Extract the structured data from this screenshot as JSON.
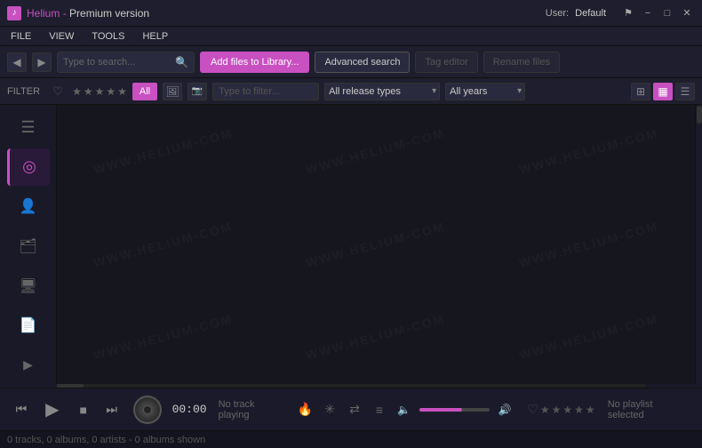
{
  "titlebar": {
    "app_name": "Helium",
    "separator": " - ",
    "version": "Premium version",
    "user_label": "User:",
    "user_name": "Default",
    "win_controls": {
      "flag": "⚑",
      "minimize": "−",
      "maximize": "□",
      "close": "✕"
    }
  },
  "menubar": {
    "items": [
      "FILE",
      "VIEW",
      "TOOLS",
      "HELP"
    ]
  },
  "toolbar": {
    "back_label": "◀",
    "forward_label": "▶",
    "search_placeholder": "Type to search...",
    "add_files_label": "Add files to Library...",
    "advanced_search_label": "Advanced search",
    "tag_editor_label": "Tag editor",
    "rename_files_label": "Rename files"
  },
  "filterbar": {
    "filter_label": "FILTER",
    "heart_icon": "♡",
    "stars": [
      "★",
      "★",
      "★",
      "★",
      "★"
    ],
    "all_label": "All",
    "type_btns": [
      "🖼",
      "🖼"
    ],
    "filter_placeholder": "Type to filter...",
    "release_types_label": "All release types",
    "years_label": "All years",
    "stack_icon": "⊞",
    "grid_icon": "⊟",
    "list_icon": "☰"
  },
  "sidebar": {
    "items": [
      {
        "icon": "≡",
        "name": "library-icon",
        "active": false
      },
      {
        "icon": "◎",
        "name": "radio-icon",
        "active": true
      },
      {
        "icon": "👤",
        "name": "artist-icon",
        "active": false
      },
      {
        "icon": "🎞",
        "name": "album-icon",
        "active": false
      },
      {
        "icon": "🖥",
        "name": "device-icon",
        "active": false
      },
      {
        "icon": "📄",
        "name": "playlist-icon",
        "active": false
      },
      {
        "icon": "▶",
        "name": "play-queue-icon",
        "active": false
      }
    ]
  },
  "watermarks": [
    "WWW.HELIUM-COM",
    "WWW.HELIUM-COM",
    "WWW.HELIUM-COM",
    "WWW.HELIUM-COM",
    "WWW.HELIUM-COM",
    "WWW.HELIUM-COM",
    "WWW.HELIUM-COM",
    "WWW.HELIUM-COM",
    "WWW.HELIUM-COM"
  ],
  "player": {
    "prev_icon": "⏮",
    "play_icon": "▶",
    "stop_icon": "■",
    "next_icon": "⏭",
    "time": "00:00",
    "no_track": "No track playing",
    "flame_icon": "🔥",
    "snowflake_icon": "✳",
    "shuffle_icon": "⇄",
    "menu_icon": "≡",
    "volume_down": "🔈",
    "volume_up": "🔊",
    "heart_icon": "♡",
    "stars": [
      "★",
      "★",
      "★",
      "★",
      "★"
    ],
    "no_playlist": "No playlist selected"
  },
  "statusbar": {
    "text": "0 tracks, 0 albums, 0 artists  -  0 albums shown"
  }
}
